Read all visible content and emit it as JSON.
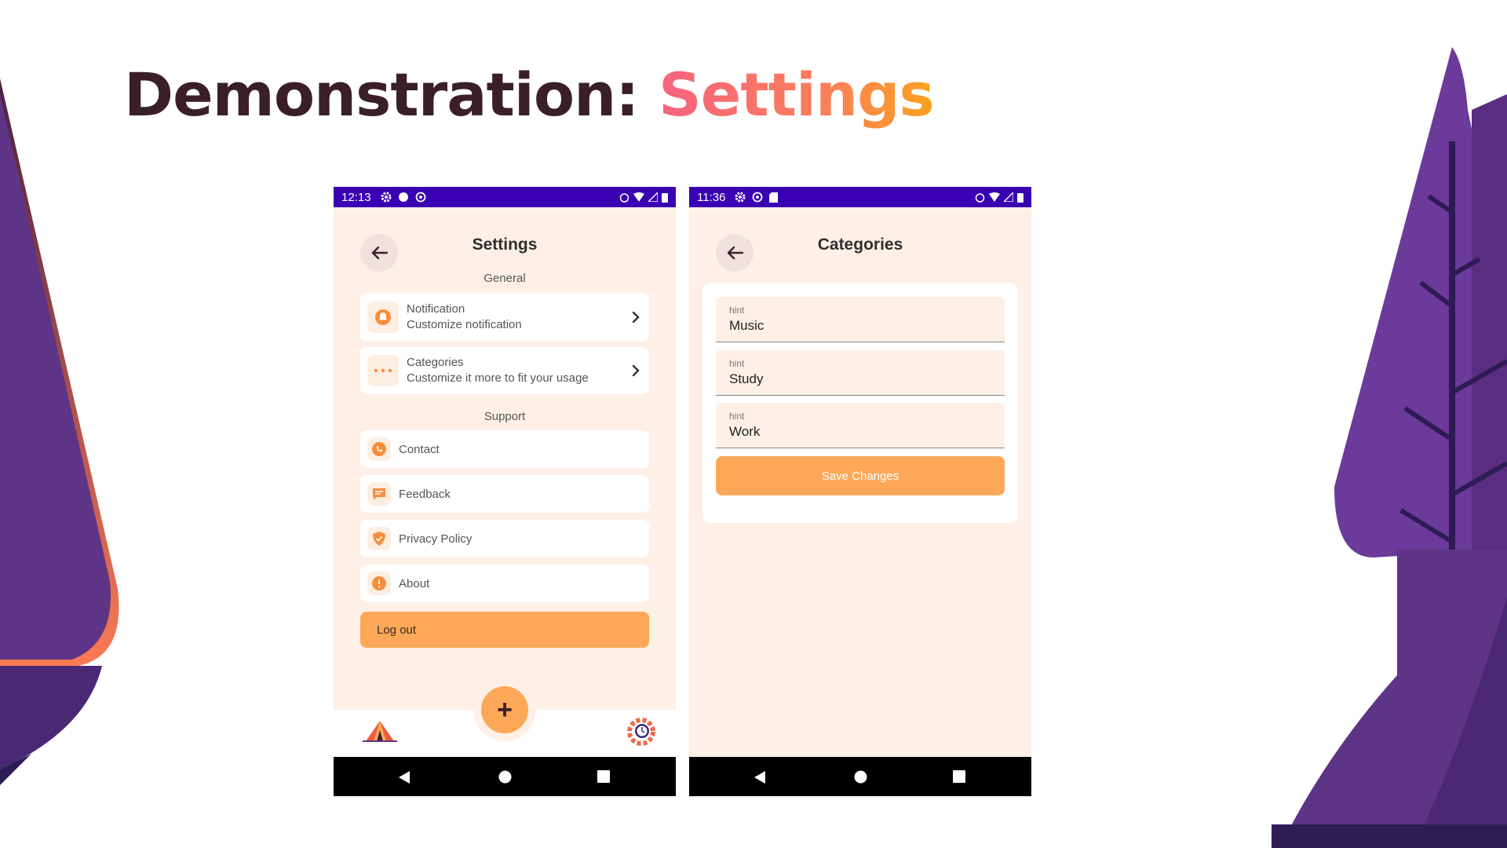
{
  "slide": {
    "title_part1": "Demonstration: ",
    "title_part2": "Settings"
  },
  "colors": {
    "accent_orange": "#fda858",
    "status_bar": "#3a00b3",
    "screen_bg": "#fef0e6",
    "tree_purple": "#5a2d80"
  },
  "settings_screen": {
    "status_time": "12:13",
    "title": "Settings",
    "general_label": "General",
    "items_general": [
      {
        "title": "Notification",
        "subtitle": "Customize notification",
        "icon": "bell-icon"
      },
      {
        "title": "Categories",
        "subtitle": "Customize it more to fit your usage",
        "icon": "dots-icon"
      }
    ],
    "support_label": "Support",
    "items_support": [
      {
        "label": "Contact",
        "icon": "phone-icon"
      },
      {
        "label": "Feedback",
        "icon": "message-icon"
      },
      {
        "label": "Privacy Policy",
        "icon": "shield-icon"
      },
      {
        "label": "About",
        "icon": "info-icon"
      }
    ],
    "logout_label": "Log out",
    "fab_label": "+"
  },
  "categories_screen": {
    "status_time": "11:36",
    "title": "Categories",
    "fields": [
      {
        "hint": "hint",
        "value": "Music"
      },
      {
        "hint": "hint",
        "value": "Study"
      },
      {
        "hint": "hint",
        "value": "Work"
      }
    ],
    "save_label": "Save Changes"
  }
}
